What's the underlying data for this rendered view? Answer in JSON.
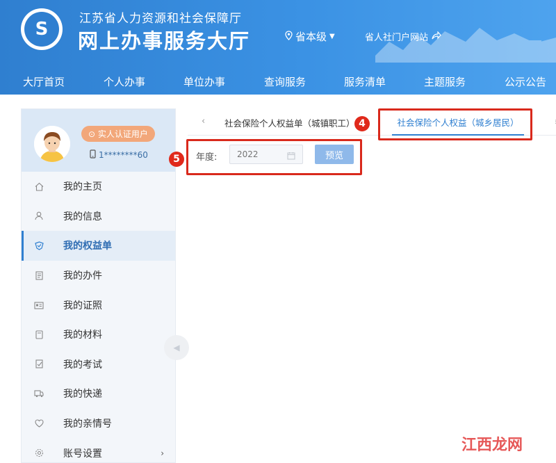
{
  "header": {
    "title_small": "江苏省人力资源和社会保障厅",
    "title_big": "网上办事服务大厅",
    "region": "省本级",
    "portal_link": "省人社门户网站"
  },
  "nav": {
    "items": [
      "大厅首页",
      "个人办事",
      "单位办事",
      "查询服务",
      "服务清单",
      "主题服务",
      "公示公告"
    ]
  },
  "profile": {
    "badge": "实人认证用户",
    "phone": "1********60"
  },
  "sidebar": {
    "items": [
      {
        "label": "我的主页",
        "icon": "home-icon"
      },
      {
        "label": "我的信息",
        "icon": "user-icon"
      },
      {
        "label": "我的权益单",
        "icon": "shield-icon",
        "active": true
      },
      {
        "label": "我的办件",
        "icon": "file-icon"
      },
      {
        "label": "我的证照",
        "icon": "id-card-icon"
      },
      {
        "label": "我的材料",
        "icon": "folder-icon"
      },
      {
        "label": "我的考试",
        "icon": "exam-icon"
      },
      {
        "label": "我的快递",
        "icon": "truck-icon"
      },
      {
        "label": "我的亲情号",
        "icon": "heart-icon"
      },
      {
        "label": "账号设置",
        "icon": "gear-icon"
      }
    ]
  },
  "tabs": {
    "tab1": "社会保险个人权益单（城镇职工）",
    "tab2": "社会保险个人权益（城乡居民）"
  },
  "markers": {
    "m4": "4",
    "m5": "5"
  },
  "filter": {
    "year_label": "年度:",
    "year_placeholder": "2022",
    "preview_label": "预览"
  },
  "watermark": "江西龙网",
  "colors": {
    "brand": "#2f7fd0",
    "highlight": "#d9291c",
    "button": "#8fb9ea"
  }
}
